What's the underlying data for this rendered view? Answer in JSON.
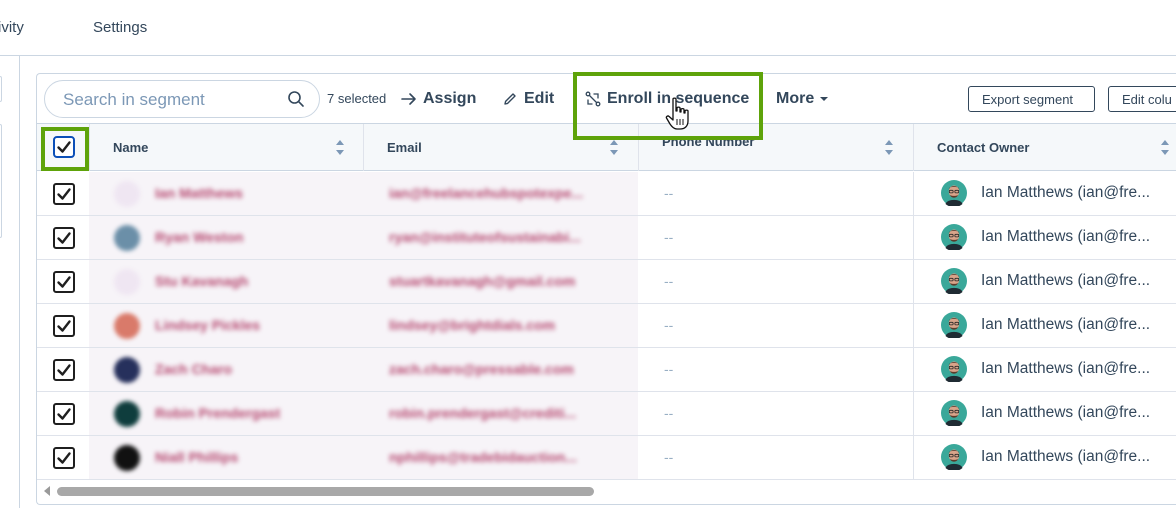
{
  "tabs": {
    "activity": "ivity",
    "settings": "Settings"
  },
  "toolbar": {
    "search_placeholder": "Search in segment",
    "selected_count": "7 selected",
    "assign": "Assign",
    "edit": "Edit",
    "enroll": "Enroll in sequence",
    "more": "More",
    "export": "Export segment",
    "edit_columns": "Edit colu"
  },
  "columns": {
    "name": "Name",
    "email": "Email",
    "phone": "Phone Number",
    "owner": "Contact Owner"
  },
  "rows": [
    {
      "name": "Ian Matthews",
      "email": "ian@freelancehubspotexpe...",
      "phone": "--",
      "owner": "Ian Matthews (ian@fre...",
      "avatar_color": "#efe6f2"
    },
    {
      "name": "Ryan Weston",
      "email": "ryan@instituteofsustainabi...",
      "phone": "--",
      "owner": "Ian Matthews (ian@fre...",
      "avatar_color": "#6b8fa8"
    },
    {
      "name": "Stu Kavanagh",
      "email": "stuartkavanagh@gmail.com",
      "phone": "--",
      "owner": "Ian Matthews (ian@fre...",
      "avatar_color": "#efe6f2"
    },
    {
      "name": "Lindsey Pickles",
      "email": "lindsey@brightdials.com",
      "phone": "--",
      "owner": "Ian Matthews (ian@fre...",
      "avatar_color": "#d97a6a"
    },
    {
      "name": "Zach Charo",
      "email": "zach.charo@pressable.com",
      "phone": "--",
      "owner": "Ian Matthews (ian@fre...",
      "avatar_color": "#26305c"
    },
    {
      "name": "Robin Prendergast",
      "email": "robin.prendergast@crediti...",
      "phone": "--",
      "owner": "Ian Matthews (ian@fre...",
      "avatar_color": "#0f3d3d"
    },
    {
      "name": "Niall Phillips",
      "email": "nphillips@tradebidauction...",
      "phone": "--",
      "owner": "Ian Matthews (ian@fre...",
      "avatar_color": "#111111"
    }
  ],
  "colors": {
    "highlight": "#5ea30a",
    "link": "#b5476f",
    "header_bg": "#f5f8fa",
    "checkbox_focus": "#0b4fb8"
  }
}
